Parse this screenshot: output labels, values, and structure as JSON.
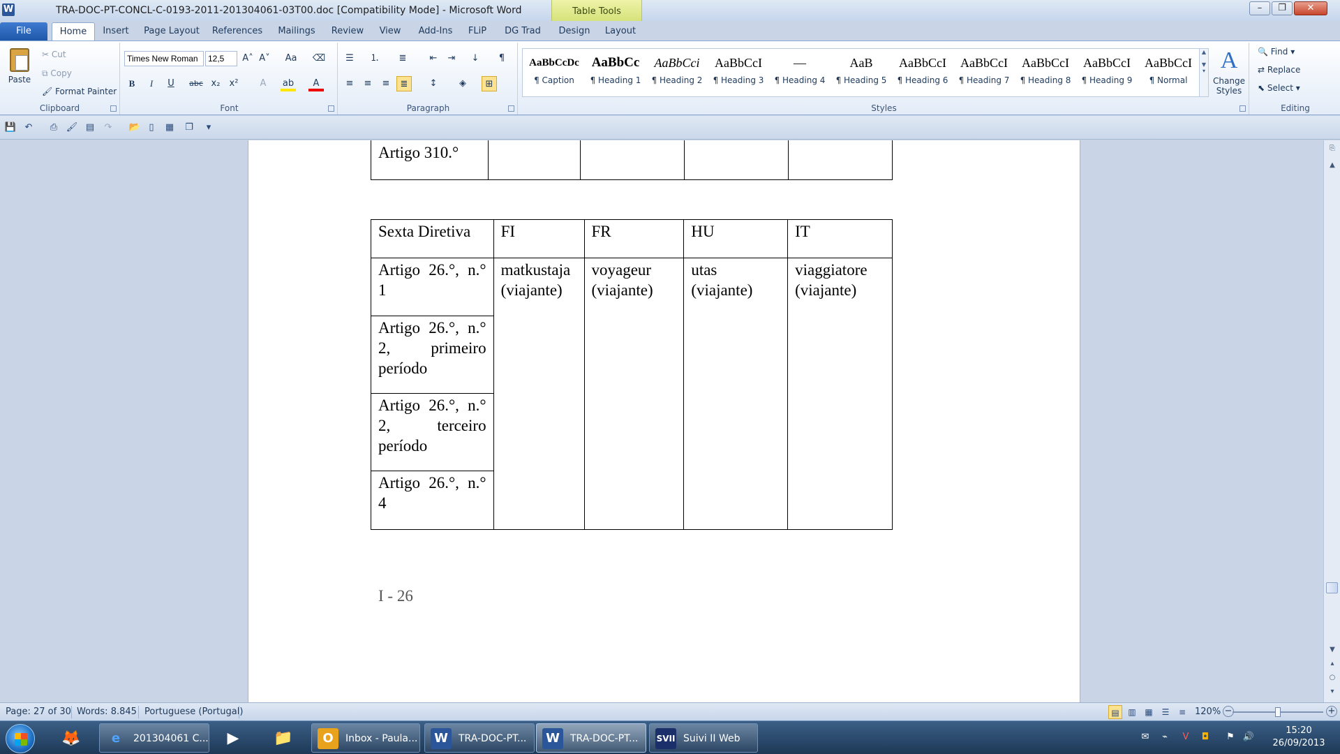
{
  "window": {
    "title": "TRA-DOC-PT-CONCL-C-0193-2011-201304061-03T00.doc [Compatibility Mode] - Microsoft Word",
    "contextual_tab": "Table Tools",
    "app_icon": "W",
    "minimize": "–",
    "maximize": "❐",
    "close": "✕"
  },
  "tabs": [
    "File",
    "Home",
    "Insert",
    "Page Layout",
    "References",
    "Mailings",
    "Review",
    "View",
    "Add-Ins",
    "FLiP",
    "DG Trad",
    "Design",
    "Layout"
  ],
  "ribbon": {
    "clipboard": {
      "paste": "Paste",
      "cut": "Cut",
      "copy": "Copy",
      "format_painter": "Format Painter",
      "label": "Clipboard"
    },
    "font": {
      "name": "Times New Roman",
      "size": "12,5",
      "label": "Font"
    },
    "paragraph": {
      "label": "Paragraph"
    },
    "styles": {
      "label": "Styles",
      "items": [
        {
          "sample": "AaBbCcDc",
          "name": "¶ Caption"
        },
        {
          "sample": "AaBbCc",
          "name": "¶ Heading 1"
        },
        {
          "sample": "AaBbCci",
          "name": "¶ Heading 2"
        },
        {
          "sample": "AaBbCcI",
          "name": "¶ Heading 3"
        },
        {
          "sample": "—",
          "name": "¶ Heading 4"
        },
        {
          "sample": "AaB",
          "name": "¶ Heading 5"
        },
        {
          "sample": "AaBbCcI",
          "name": "¶ Heading 6"
        },
        {
          "sample": "AaBbCcI",
          "name": "¶ Heading 7"
        },
        {
          "sample": "AaBbCcI",
          "name": "¶ Heading 8"
        },
        {
          "sample": "AaBbCcI",
          "name": "¶ Heading 9"
        },
        {
          "sample": "AaBbCcI",
          "name": "¶ Normal"
        },
        {
          "sample": "AaBbCcI",
          "name": "¶ Normal"
        }
      ],
      "change_styles": "Change Styles"
    },
    "editing": {
      "label": "Editing",
      "find": "Find",
      "replace": "Replace",
      "select": "Select"
    }
  },
  "document": {
    "table1": {
      "cell": "Artigo 310.°"
    },
    "table2": {
      "headers": [
        "Sexta Diretiva",
        "FI",
        "FR",
        "HU",
        "IT"
      ],
      "rows": [
        "Artigo 26.°, n.° 1",
        "Artigo 26.°, n.° 2, primeiro período",
        "Artigo 26.°, n.° 2, terceiro período",
        "Artigo 26.°, n.° 4"
      ],
      "translations": [
        "matkustaja (viajante)",
        "voyageur (viajante)",
        "utas (viajante)",
        "viaggiatore (viajante)"
      ]
    },
    "page_footer": "I - 26"
  },
  "statusbar": {
    "page": "Page: 27 of 30",
    "words": "Words: 8.845",
    "language": "Portuguese (Portugal)",
    "zoom": "120%",
    "zoom_fraction": 0.5
  },
  "taskbar": {
    "tasks": [
      {
        "label": "201304061 C...",
        "icon": "ie-icon"
      },
      {
        "label": "Inbox - Paula...",
        "icon": "outlook-icon"
      },
      {
        "label": "TRA-DOC-PT...",
        "icon": "word-icon"
      },
      {
        "label": "TRA-DOC-PT...",
        "icon": "word-icon"
      },
      {
        "label": "Suivi II Web",
        "icon": "svii-icon"
      }
    ],
    "svii_badge": "SVII",
    "word_badge": "W",
    "outlook_badge": "O",
    "time": "15:20",
    "date": "26/09/2013"
  }
}
